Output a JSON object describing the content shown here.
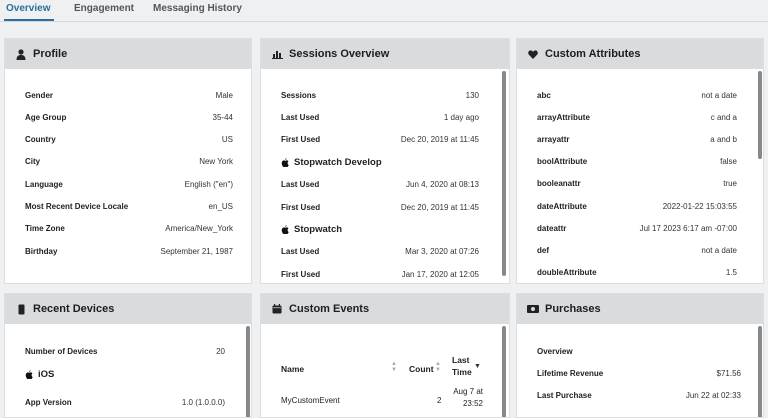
{
  "tabs": [
    {
      "label": "Overview"
    },
    {
      "label": "Engagement"
    },
    {
      "label": "Messaging History"
    }
  ],
  "profile": {
    "title": "Profile",
    "rows": [
      {
        "k": "Gender",
        "v": "Male"
      },
      {
        "k": "Age Group",
        "v": "35-44"
      },
      {
        "k": "Country",
        "v": "US"
      },
      {
        "k": "City",
        "v": "New York"
      },
      {
        "k": "Language",
        "v": "English (\"en\")"
      },
      {
        "k": "Most Recent Device Locale",
        "v": "en_US"
      },
      {
        "k": "Time Zone",
        "v": "America/New_York"
      },
      {
        "k": "Birthday",
        "v": "September 21, 1987"
      }
    ]
  },
  "sessions": {
    "title": "Sessions Overview",
    "rows": [
      {
        "k": "Sessions",
        "v": "130"
      },
      {
        "k": "Last Used",
        "v": "1 day ago"
      },
      {
        "k": "First Used",
        "v": "Dec 20, 2019 at 11:45"
      }
    ],
    "apps": [
      {
        "name": "Stopwatch Develop",
        "rows": [
          {
            "k": "Last Used",
            "v": "Jun 4, 2020 at 08:13"
          },
          {
            "k": "First Used",
            "v": "Dec 20, 2019 at 11:45"
          }
        ]
      },
      {
        "name": "Stopwatch",
        "rows": [
          {
            "k": "Last Used",
            "v": "Mar 3, 2020 at 07:26"
          },
          {
            "k": "First Used",
            "v": "Jan 17, 2020 at 12:05"
          }
        ]
      }
    ]
  },
  "custom_attributes": {
    "title": "Custom Attributes",
    "rows": [
      {
        "k": "abc",
        "v": "not a date"
      },
      {
        "k": "arrayAttribute",
        "v": "c and a"
      },
      {
        "k": "arrayattr",
        "v": "a and b"
      },
      {
        "k": "boolAttribute",
        "v": "false"
      },
      {
        "k": "booleanattr",
        "v": "true"
      },
      {
        "k": "dateAttribute",
        "v": "2022-01-22 15:03:55"
      },
      {
        "k": "dateattr",
        "v": "Jul 17 2023 6:17 am -07:00"
      },
      {
        "k": "def",
        "v": "not a date"
      },
      {
        "k": "doubleAttribute",
        "v": "1.5"
      }
    ]
  },
  "recent_devices": {
    "title": "Recent Devices",
    "number_label": "Number of Devices",
    "number_value": "20",
    "os": "iOS",
    "app_version_label": "App Version",
    "app_version_value": "1.0 (1.0.0.0)"
  },
  "custom_events": {
    "title": "Custom Events",
    "col_name": "Name",
    "col_count": "Count",
    "col_last_time": "Last\nTime",
    "rows": [
      {
        "name": "MyCustomEvent",
        "count": "2",
        "last_time": "Aug 7 at\n23:52"
      }
    ]
  },
  "purchases": {
    "title": "Purchases",
    "section": "Overview",
    "rows": [
      {
        "k": "Lifetime Revenue",
        "v": "$71.56"
      },
      {
        "k": "Last Purchase",
        "v": "Jun 22 at 02:33"
      }
    ]
  },
  "colors": {
    "accent": "#2a6f9a",
    "header_bg": "#d9dcdf",
    "page_bg": "#eef0f2"
  }
}
